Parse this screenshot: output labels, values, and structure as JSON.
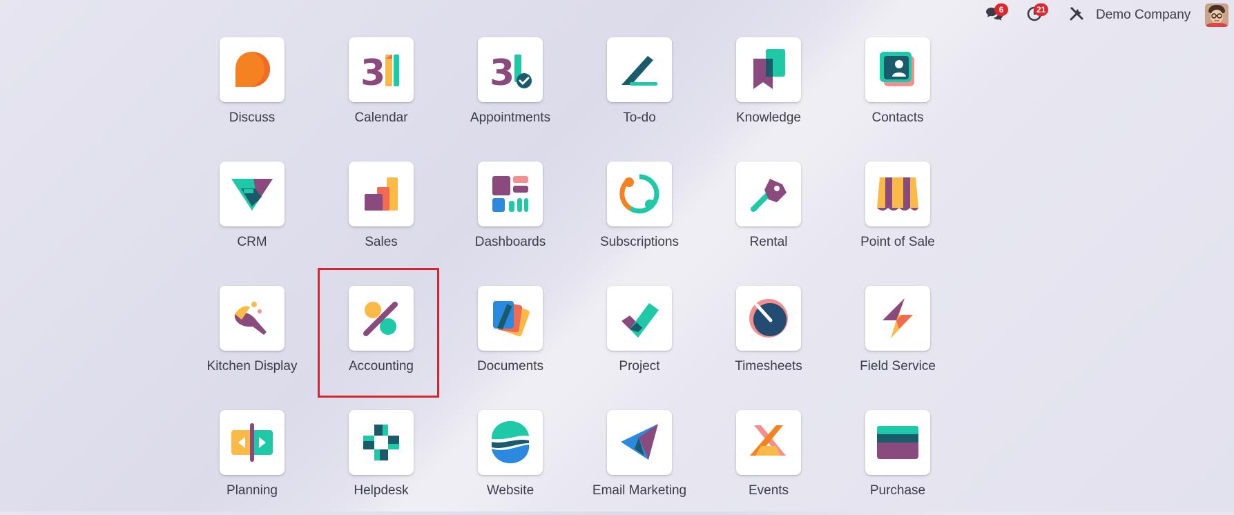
{
  "topbar": {
    "messages_badge": "6",
    "activities_badge": "21",
    "company_name": "Demo Company"
  },
  "apps": [
    {
      "label": "Discuss",
      "icon": "discuss-icon"
    },
    {
      "label": "Calendar",
      "icon": "calendar-icon"
    },
    {
      "label": "Appointments",
      "icon": "appointments-icon"
    },
    {
      "label": "To-do",
      "icon": "todo-icon"
    },
    {
      "label": "Knowledge",
      "icon": "knowledge-icon"
    },
    {
      "label": "Contacts",
      "icon": "contacts-icon"
    },
    {
      "label": "CRM",
      "icon": "crm-icon"
    },
    {
      "label": "Sales",
      "icon": "sales-icon"
    },
    {
      "label": "Dashboards",
      "icon": "dashboards-icon"
    },
    {
      "label": "Subscriptions",
      "icon": "subscriptions-icon"
    },
    {
      "label": "Rental",
      "icon": "rental-icon"
    },
    {
      "label": "Point of Sale",
      "icon": "point-of-sale-icon"
    },
    {
      "label": "Kitchen Display",
      "icon": "kitchen-display-icon"
    },
    {
      "label": "Accounting",
      "icon": "accounting-icon"
    },
    {
      "label": "Documents",
      "icon": "documents-icon"
    },
    {
      "label": "Project",
      "icon": "project-icon"
    },
    {
      "label": "Timesheets",
      "icon": "timesheets-icon"
    },
    {
      "label": "Field Service",
      "icon": "field-service-icon"
    },
    {
      "label": "Planning",
      "icon": "planning-icon"
    },
    {
      "label": "Helpdesk",
      "icon": "helpdesk-icon"
    },
    {
      "label": "Website",
      "icon": "website-icon"
    },
    {
      "label": "Email Marketing",
      "icon": "email-marketing-icon"
    },
    {
      "label": "Events",
      "icon": "events-icon"
    },
    {
      "label": "Purchase",
      "icon": "purchase-icon"
    }
  ],
  "highlighted_app": "Accounting",
  "colors": {
    "highlight_border": "#d4262f",
    "badge": "#e0262d",
    "teal": "#1ec9a7",
    "purple": "#8b4a7d",
    "orange": "#f58220",
    "yellow": "#fbb945"
  }
}
